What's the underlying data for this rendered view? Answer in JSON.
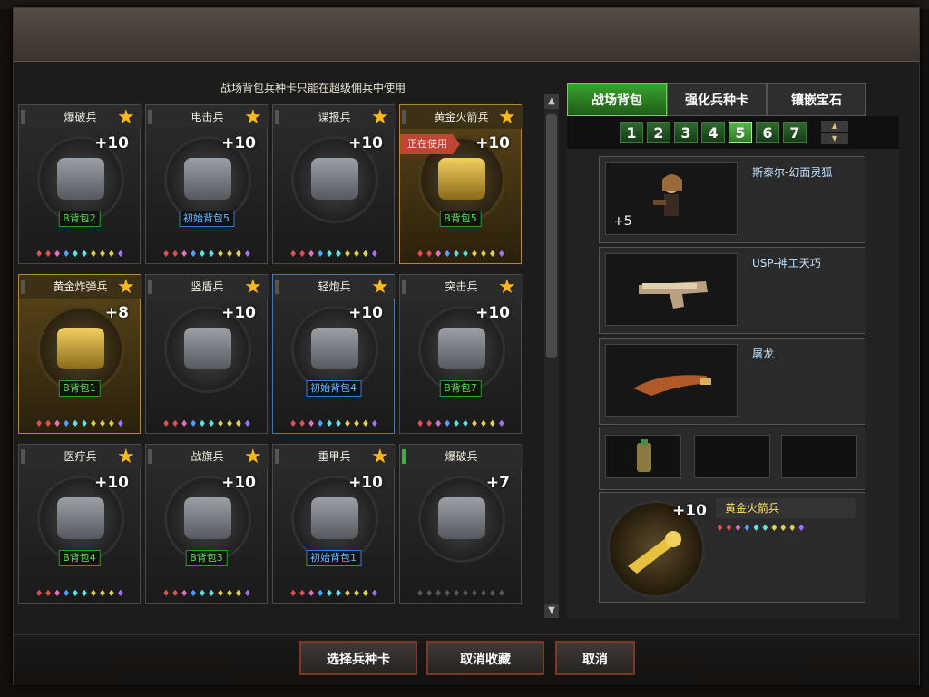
{
  "notice": "战场背包兵种卡只能在超级佣兵中使用",
  "cards": [
    {
      "title": "爆破兵",
      "level": "+10",
      "badge": "B背包2",
      "badge_type": "green",
      "star": true,
      "tab": "gray",
      "style": "normal",
      "item": "steel",
      "gems": "♦♦♦♦♦♦♦♦♦♦"
    },
    {
      "title": "电击兵",
      "level": "+10",
      "badge": "初始背包5",
      "badge_type": "blue",
      "star": true,
      "tab": "gray",
      "style": "normal",
      "item": "steel",
      "gems": "♦♦♦♦♦♦♦♦♦♦"
    },
    {
      "title": "谍报兵",
      "level": "+10",
      "badge": "",
      "badge_type": "none",
      "star": true,
      "tab": "gray",
      "style": "normal",
      "item": "steel",
      "gems": "♦♦♦♦♦♦♦♦♦♦"
    },
    {
      "title": "黄金火箭兵",
      "level": "+10",
      "badge": "B背包5",
      "badge_type": "green",
      "star": true,
      "tab": "gray",
      "style": "gold",
      "item": "gold",
      "gems": "♦♦♦♦♦♦♦♦♦♦",
      "in_use": "正在使用"
    },
    {
      "title": "黄金炸弹兵",
      "level": "+8",
      "badge": "B背包1",
      "badge_type": "green",
      "star": true,
      "tab": "gray",
      "style": "gold",
      "item": "gold",
      "gems": "♦♦♦♦♦♦♦♦♦♦"
    },
    {
      "title": "竖盾兵",
      "level": "+10",
      "badge": "",
      "badge_type": "none",
      "star": true,
      "tab": "gray",
      "style": "normal",
      "item": "steel",
      "gems": "♦♦♦♦♦♦♦♦♦♦"
    },
    {
      "title": "轻炮兵",
      "level": "+10",
      "badge": "初始背包4",
      "badge_type": "blue",
      "star": true,
      "tab": "gray",
      "style": "selected",
      "item": "steel",
      "gems": "♦♦♦♦♦♦♦♦♦♦"
    },
    {
      "title": "突击兵",
      "level": "+10",
      "badge": "B背包7",
      "badge_type": "green",
      "star": true,
      "tab": "gray",
      "style": "normal",
      "item": "steel",
      "gems": "♦♦♦♦♦♦♦♦♦♦"
    },
    {
      "title": "医疗兵",
      "level": "+10",
      "badge": "B背包4",
      "badge_type": "green",
      "star": true,
      "tab": "gray",
      "style": "normal",
      "item": "steel",
      "gems": "♦♦♦♦♦♦♦♦♦♦"
    },
    {
      "title": "战旗兵",
      "level": "+10",
      "badge": "B背包3",
      "badge_type": "green",
      "star": true,
      "tab": "gray",
      "style": "normal",
      "item": "steel",
      "gems": "♦♦♦♦♦♦♦♦♦♦"
    },
    {
      "title": "重甲兵",
      "level": "+10",
      "badge": "初始背包1",
      "badge_type": "blue",
      "star": true,
      "tab": "gray",
      "style": "normal",
      "item": "steel",
      "gems": "♦♦♦♦♦♦♦♦♦♦"
    },
    {
      "title": "爆破兵",
      "level": "+7",
      "badge": "",
      "badge_type": "none",
      "star": false,
      "tab": "green",
      "style": "normal",
      "item": "steel",
      "gems": "♦♦♦♦♦♦♦♦♦♦",
      "gems_dim": true
    }
  ],
  "tabs": [
    "战场背包",
    "强化兵种卡",
    "镶嵌宝石"
  ],
  "pages": [
    "1",
    "2",
    "3",
    "4",
    "5",
    "6",
    "7"
  ],
  "active_page": "5",
  "slots": {
    "character": {
      "name": "斯泰尔-幻面灵狐",
      "bonus": "+5"
    },
    "pistol": {
      "name": "USP-神工天巧"
    },
    "melee": {
      "name": "屠龙"
    },
    "soldier": {
      "name": "黄金火箭兵",
      "level": "+10",
      "gems": "♦♦♦♦♦♦♦♦♦♦"
    }
  },
  "buttons": {
    "select": "选择兵种卡",
    "cancel_fav": "取消收藏",
    "cancel": "取消"
  },
  "colors": {
    "active_tab": "#3ba02e",
    "gold_card": "#b08a30",
    "selected_card": "#4a79a4",
    "star": "#ffb81c"
  }
}
